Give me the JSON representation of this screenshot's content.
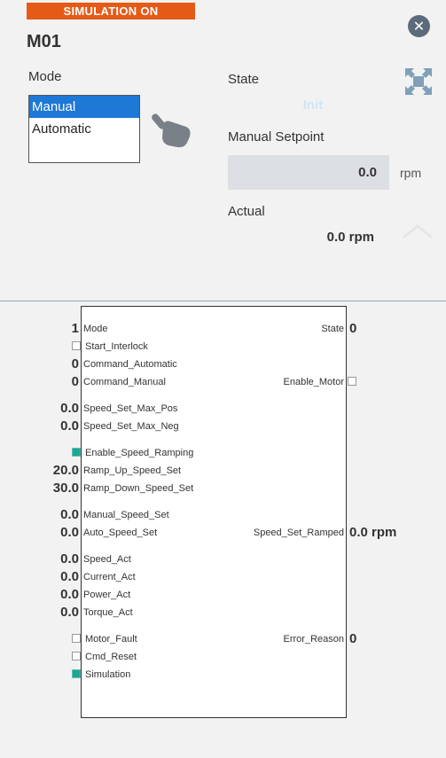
{
  "banner": "SIMULATION ON",
  "title": "M01",
  "mode": {
    "label": "Mode",
    "options": [
      "Manual",
      "Automatic"
    ],
    "selected": "Manual"
  },
  "state": {
    "label": "State",
    "value": "Init"
  },
  "manual_setpoint": {
    "label": "Manual Setpoint",
    "value": "0.0",
    "unit": "rpm"
  },
  "actual": {
    "label": "Actual",
    "value": "0.0 rpm"
  },
  "function_block": {
    "inputs": {
      "mode": {
        "label": "Mode",
        "value": "1"
      },
      "start_interlock": {
        "label": "Start_Interlock"
      },
      "command_automatic": {
        "label": "Command_Automatic",
        "value": "0"
      },
      "command_manual": {
        "label": "Command_Manual",
        "value": "0"
      },
      "speed_set_max_pos": {
        "label": "Speed_Set_Max_Pos",
        "value": "0.0"
      },
      "speed_set_max_neg": {
        "label": "Speed_Set_Max_Neg",
        "value": "0.0"
      },
      "enable_speed_ramping": {
        "label": "Enable_Speed_Ramping"
      },
      "ramp_up_speed_set": {
        "label": "Ramp_Up_Speed_Set",
        "value": "20.0"
      },
      "ramp_down_speed_set": {
        "label": "Ramp_Down_Speed_Set",
        "value": "30.0"
      },
      "manual_speed_set": {
        "label": "Manual_Speed_Set",
        "value": "0.0"
      },
      "auto_speed_set": {
        "label": "Auto_Speed_Set",
        "value": "0.0"
      },
      "speed_act": {
        "label": "Speed_Act",
        "value": "0.0"
      },
      "current_act": {
        "label": "Current_Act",
        "value": "0.0"
      },
      "power_act": {
        "label": "Power_Act",
        "value": "0.0"
      },
      "torque_act": {
        "label": "Torque_Act",
        "value": "0.0"
      },
      "motor_fault": {
        "label": "Motor_Fault"
      },
      "cmd_reset": {
        "label": "Cmd_Reset"
      },
      "simulation": {
        "label": "Simulation"
      }
    },
    "outputs": {
      "state": {
        "label": "State",
        "value": "0"
      },
      "enable_motor": {
        "label": "Enable_Motor"
      },
      "speed_set_ramped": {
        "label": "Speed_Set_Ramped",
        "value": "0.0 rpm"
      },
      "error_reason": {
        "label": "Error_Reason",
        "value": "0"
      }
    }
  },
  "colors": {
    "banner": "#e65a17",
    "selected": "#1e78d6",
    "check_on": "#1aa891"
  }
}
